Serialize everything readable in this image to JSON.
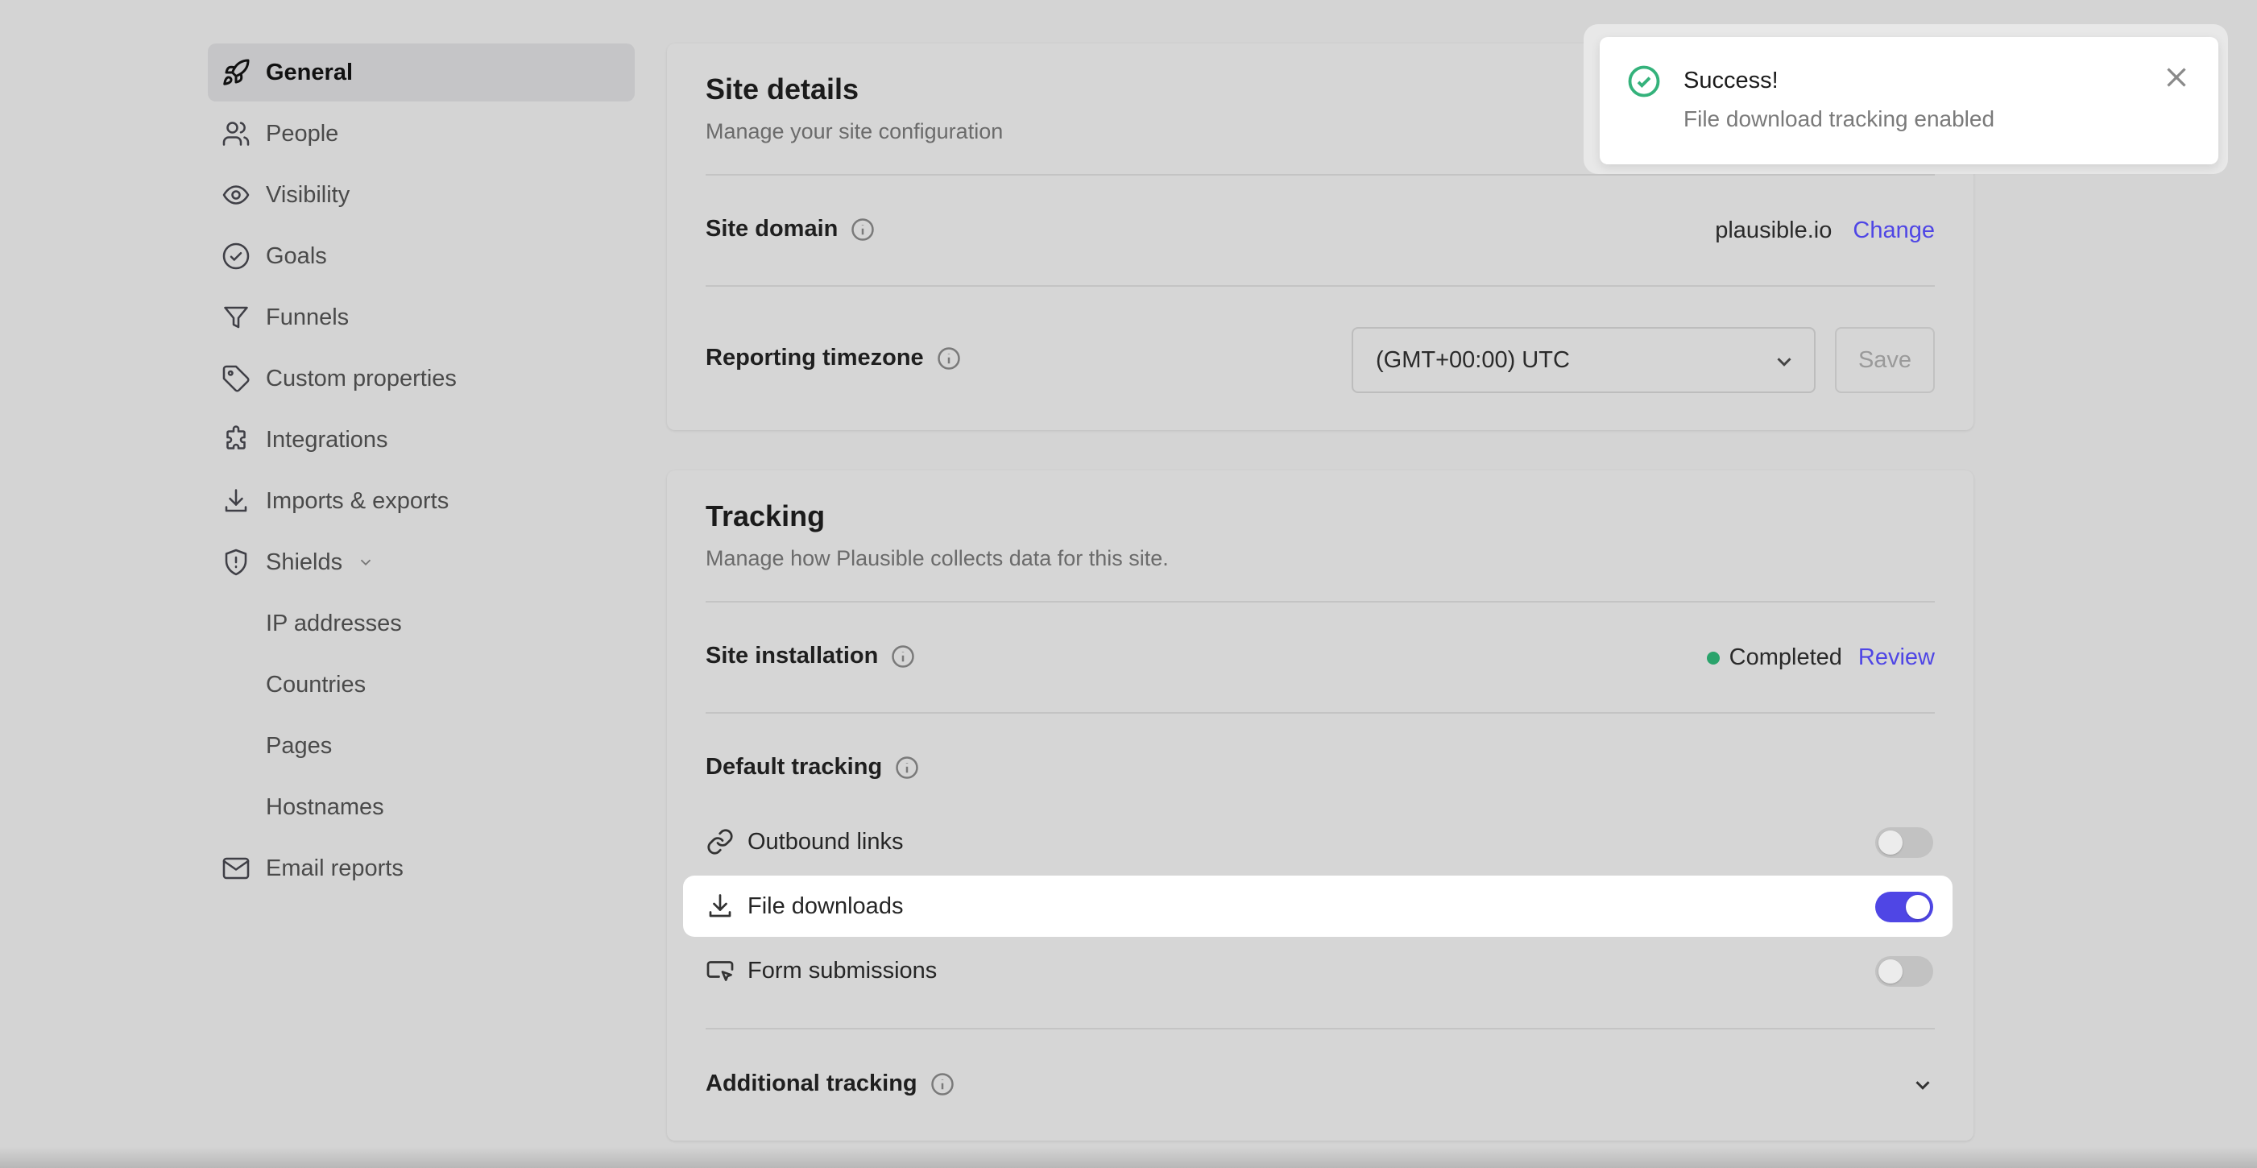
{
  "sidebar": {
    "items": [
      {
        "label": "General",
        "icon": "rocket-icon",
        "active": true
      },
      {
        "label": "People",
        "icon": "people-icon"
      },
      {
        "label": "Visibility",
        "icon": "eye-icon"
      },
      {
        "label": "Goals",
        "icon": "check-circle-icon"
      },
      {
        "label": "Funnels",
        "icon": "funnel-icon"
      },
      {
        "label": "Custom properties",
        "icon": "tag-icon"
      },
      {
        "label": "Integrations",
        "icon": "puzzle-icon"
      },
      {
        "label": "Imports & exports",
        "icon": "download-icon"
      },
      {
        "label": "Shields",
        "icon": "shield-icon"
      },
      {
        "label": "IP addresses"
      },
      {
        "label": "Countries"
      },
      {
        "label": "Pages"
      },
      {
        "label": "Hostnames"
      },
      {
        "label": "Email reports",
        "icon": "envelope-icon"
      }
    ]
  },
  "site_details": {
    "title": "Site details",
    "subtitle": "Manage your site configuration",
    "domain_label": "Site domain",
    "domain_value": "plausible.io",
    "domain_change": "Change",
    "timezone_label": "Reporting timezone",
    "timezone_value": "(GMT+00:00) UTC",
    "save_label": "Save"
  },
  "tracking": {
    "title": "Tracking",
    "subtitle": "Manage how Plausible collects data for this site.",
    "installation_label": "Site installation",
    "installation_status": "Completed",
    "installation_review": "Review",
    "default_label": "Default tracking",
    "options": [
      {
        "label": "Outbound links",
        "enabled": false
      },
      {
        "label": "File downloads",
        "enabled": true
      },
      {
        "label": "Form submissions",
        "enabled": false
      }
    ],
    "additional_label": "Additional tracking"
  },
  "toast": {
    "title": "Success!",
    "message": "File download tracking enabled"
  },
  "colors": {
    "accent": "#4f46e5",
    "success": "#34b27b",
    "status_dot": "#2aa36b"
  }
}
